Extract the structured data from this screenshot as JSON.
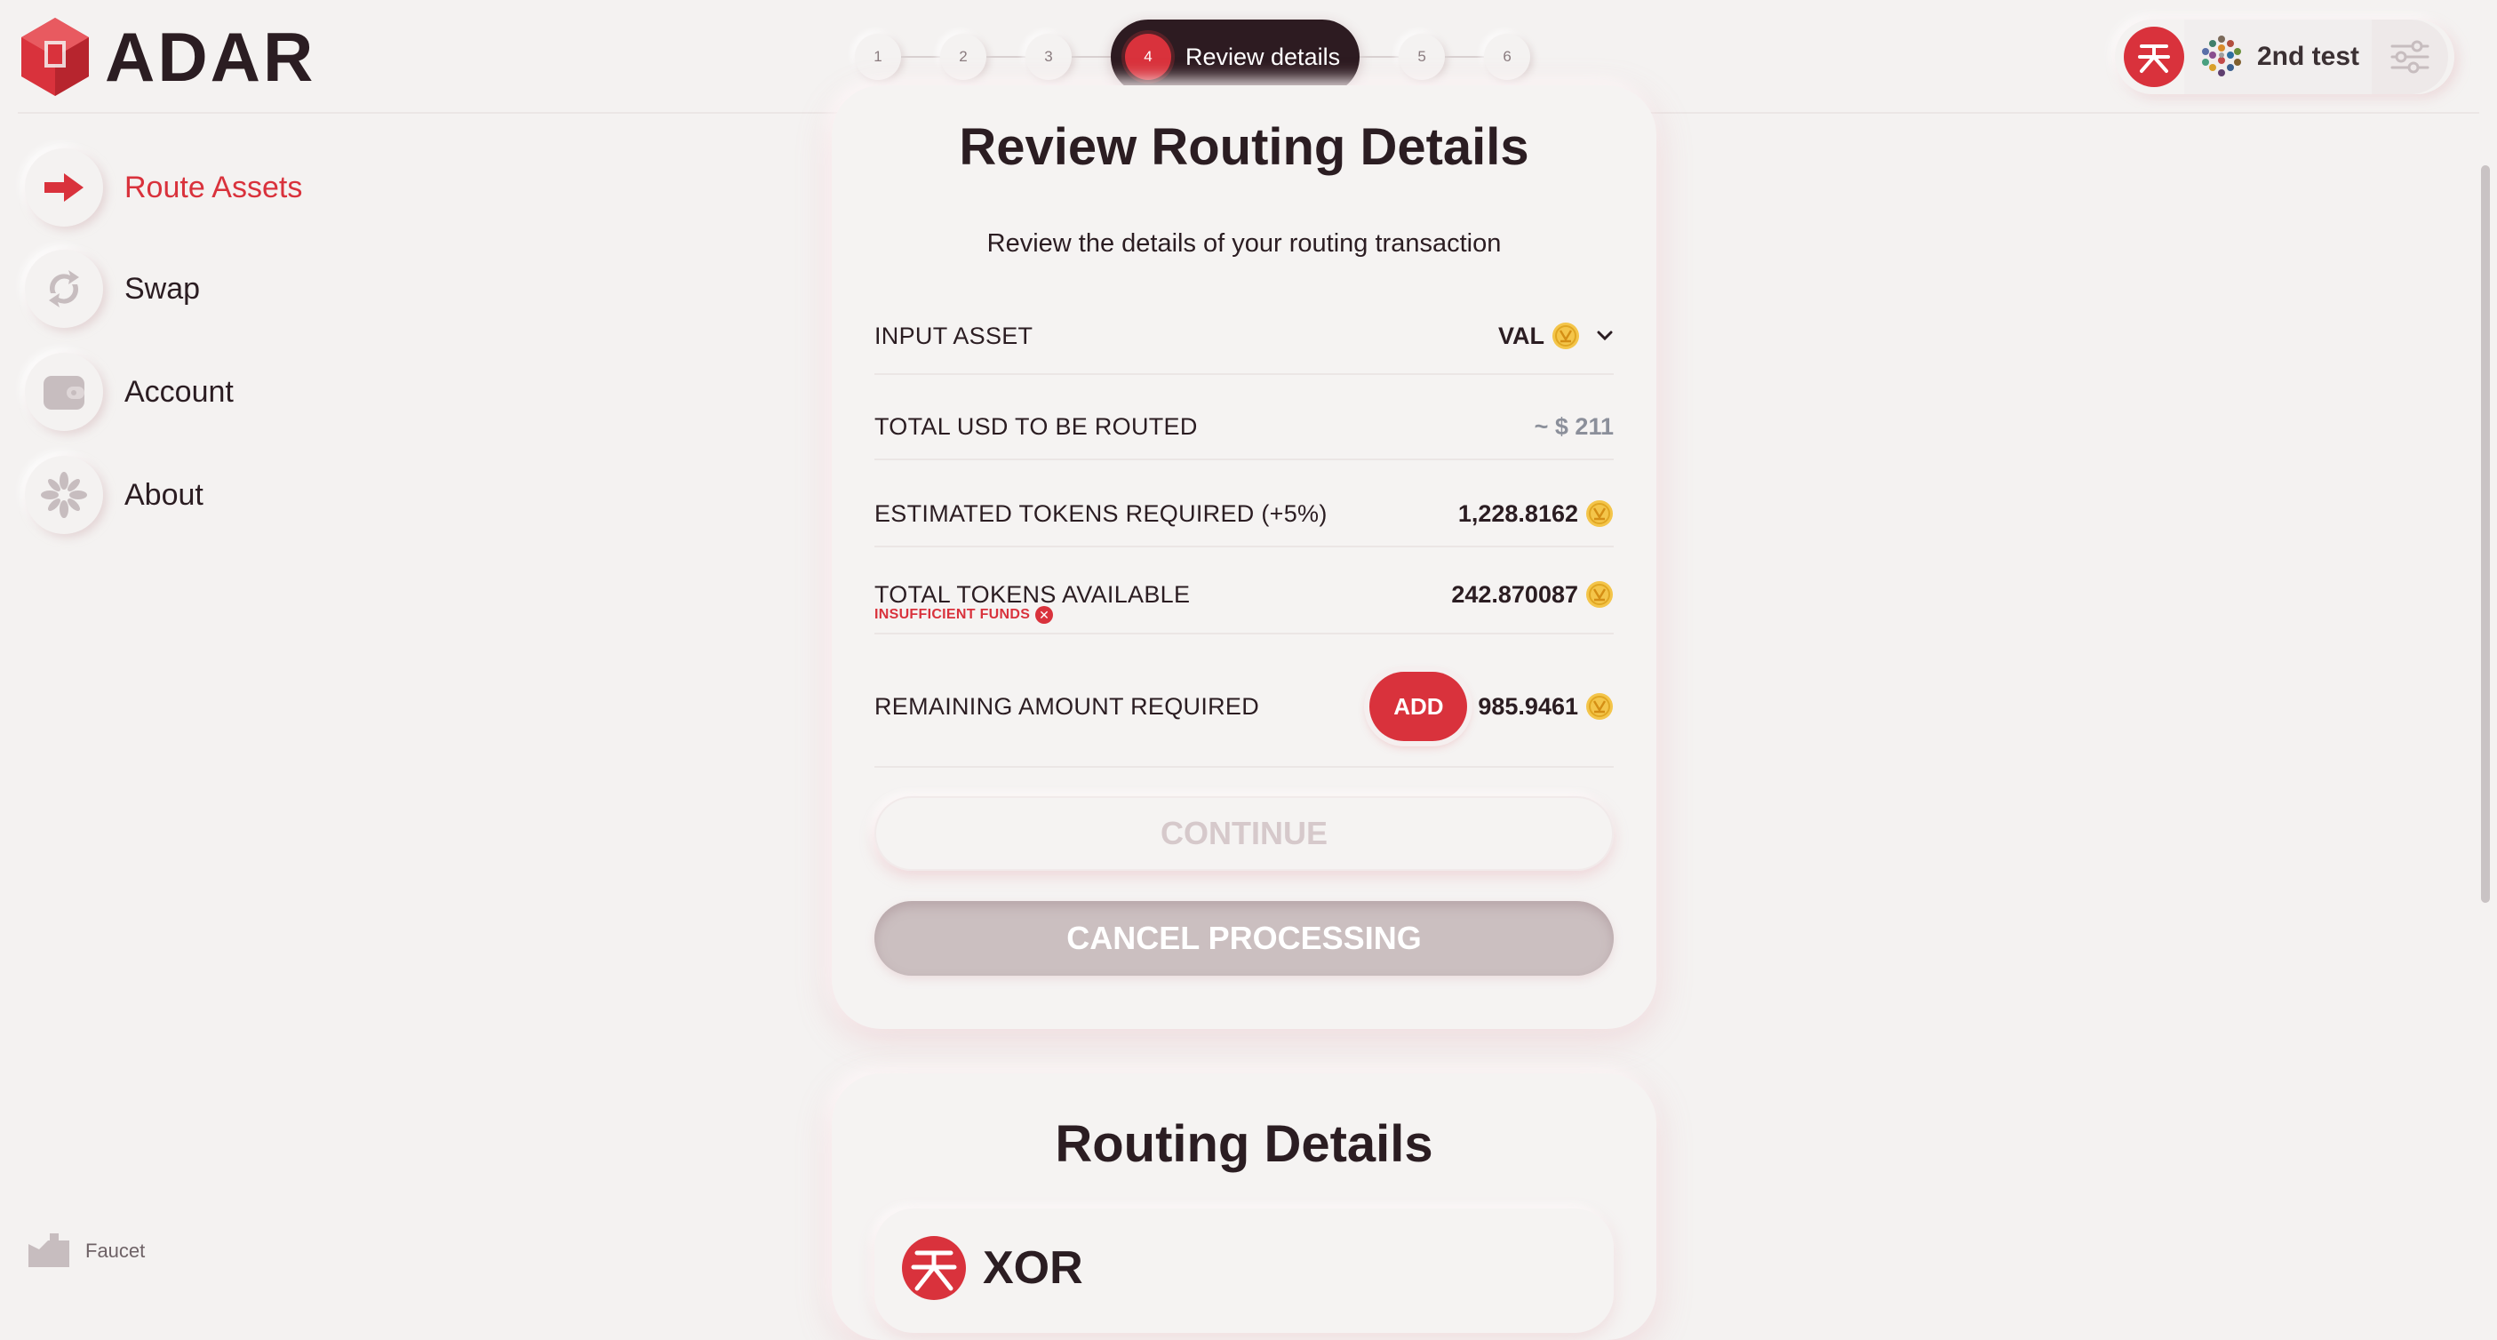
{
  "app": {
    "logo_text": "ADAR",
    "brand_color": "#d9323c"
  },
  "stepper": {
    "steps": [
      "1",
      "2",
      "3"
    ],
    "active_number": "4",
    "active_label": "Review details",
    "steps_after": [
      "5",
      "6"
    ]
  },
  "wallet": {
    "name": "2nd test",
    "avatar_icon": "sora-logo-icon",
    "identicon": "identicon-icon",
    "settings_icon": "sliders-icon"
  },
  "sidebar": {
    "items": [
      {
        "label": "Route Assets",
        "icon": "arrow-right-icon",
        "active": true
      },
      {
        "label": "Swap",
        "icon": "swap-arrows-icon",
        "active": false
      },
      {
        "label": "Account",
        "icon": "wallet-icon",
        "active": false
      },
      {
        "label": "About",
        "icon": "flower-icon",
        "active": false
      }
    ],
    "faucet_label": "Faucet"
  },
  "review": {
    "title": "Review Routing Details",
    "subtitle": "Review the details of your routing transaction",
    "input_asset_label": "INPUT ASSET",
    "input_asset_value": "VAL",
    "total_usd_label": "TOTAL USD TO BE ROUTED",
    "total_usd_value": "~ $ 211",
    "estimated_label": "ESTIMATED TOKENS REQUIRED (+5%)",
    "estimated_value": "1,228.8162",
    "available_label": "TOTAL TOKENS AVAILABLE",
    "available_value": "242.870087",
    "warning": "INSUFFICIENT FUNDS",
    "remaining_label": "REMAINING AMOUNT REQUIRED",
    "remaining_value": "985.9461",
    "add_label": "ADD",
    "continue_label": "CONTINUE",
    "cancel_label": "CANCEL PROCESSING"
  },
  "routing": {
    "title": "Routing Details",
    "asset": "XOR"
  }
}
